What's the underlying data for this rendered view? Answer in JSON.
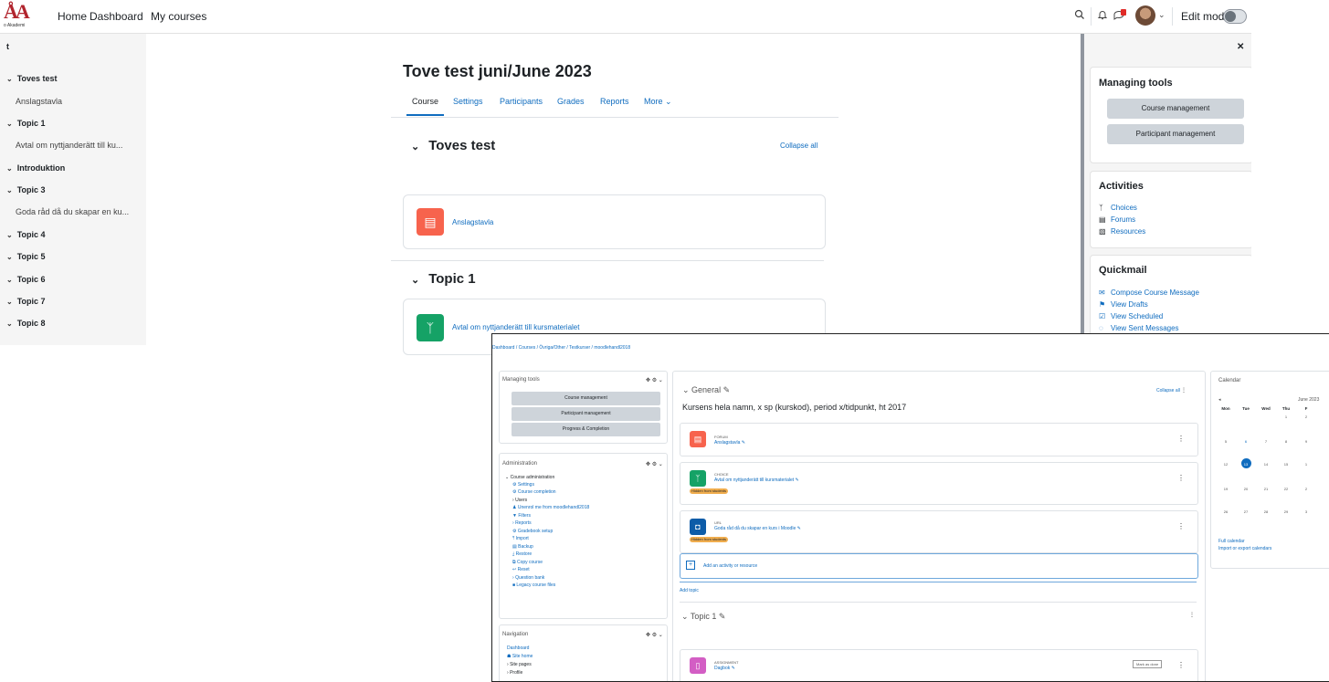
{
  "topbar": {
    "logo_text": "o Akademi",
    "nav": [
      "Home",
      "Dashboard",
      "My courses"
    ],
    "edit_mode_label": "Edit mode",
    "icons": [
      "search-icon",
      "bell-icon",
      "chat-icon",
      "avatar",
      "chevron-down-icon"
    ]
  },
  "left_drawer": {
    "top_label": "t",
    "items": [
      {
        "label": "Toves test",
        "bold": true
      },
      {
        "label": "Anslagstavla",
        "bold": false
      },
      {
        "label": "Topic 1",
        "bold": true
      },
      {
        "label": "Avtal om nyttjanderätt till ku...",
        "bold": false
      },
      {
        "label": "Introduktion",
        "bold": true
      },
      {
        "label": "Topic 3",
        "bold": true
      },
      {
        "label": "Goda råd då du skapar en ku...",
        "bold": false
      },
      {
        "label": "Topic 4",
        "bold": true
      },
      {
        "label": "Topic 5",
        "bold": true
      },
      {
        "label": "Topic 6",
        "bold": true
      },
      {
        "label": "Topic 7",
        "bold": true
      },
      {
        "label": "Topic 8",
        "bold": true
      }
    ]
  },
  "main": {
    "course_title": "Tove test juni/June 2023",
    "tabs": [
      "Course",
      "Settings",
      "Participants",
      "Grades",
      "Reports",
      "More"
    ],
    "collapse_all": "Collapse all",
    "sections": [
      {
        "title": "Toves test",
        "activity": "Anslagstavla",
        "icon": "forum-icon",
        "color": "#f7634d"
      },
      {
        "title": "Topic 1",
        "activity": "Avtal om nyttjanderätt till kursmaterialet",
        "icon": "choice-icon",
        "color": "#15a266"
      }
    ]
  },
  "right_drawer": {
    "managing_tools": {
      "title": "Managing tools",
      "buttons": [
        "Course management",
        "Participant management"
      ]
    },
    "activities": {
      "title": "Activities",
      "links": [
        {
          "label": "Choices",
          "icon": "choice-icon"
        },
        {
          "label": "Forums",
          "icon": "forum-icon"
        },
        {
          "label": "Resources",
          "icon": "file-icon"
        }
      ]
    },
    "quickmail": {
      "title": "Quickmail",
      "links": [
        {
          "label": "Compose Course Message",
          "icon": "envelope-icon"
        },
        {
          "label": "View Drafts",
          "icon": "flag-icon"
        },
        {
          "label": "View Scheduled",
          "icon": "calendar-check-icon"
        },
        {
          "label": "View Sent Messages",
          "icon": "chat-bubble-icon"
        }
      ]
    }
  },
  "overlay": {
    "breadcrumb": "Dashboard / Courses / Övriga/Other / Testkurser / moodlehandl2018",
    "managing_tools": {
      "title": "Managing tools",
      "buttons": [
        "Course management",
        "Participant management",
        "Progress & Completion"
      ]
    },
    "administration": {
      "title": "Administration",
      "heading": "Course administration",
      "items": [
        "Settings",
        "Course completion",
        "Users",
        "Unenrol me from moodlehandl2018",
        "Filters",
        "Reports",
        "Gradebook setup",
        "Import",
        "Backup",
        "Restore",
        "Copy course",
        "Reset",
        "Question bank",
        "Legacy course files"
      ]
    },
    "navigation": {
      "title": "Navigation",
      "items": [
        "Dashboard",
        "Site home",
        "Site pages",
        "Profile"
      ]
    },
    "general": {
      "title": "General",
      "collapse_all": "Collapse all",
      "summary": "Kursens hela namn, x sp (kurskod), period x/tidpunkt, ht 2017",
      "activities": [
        {
          "type": "FORUM",
          "name": "Anslagstavla",
          "badge": "",
          "color": "#f7634d"
        },
        {
          "type": "CHOICE",
          "name": "Avtal om nyttjanderätt till kursmaterialet",
          "badge": "Hidden from students",
          "color": "#15a266"
        },
        {
          "type": "URL",
          "name": "Goda råd då du skapar en kurs i Moodle",
          "badge": "Hidden from students",
          "color": "#0d5ca8"
        }
      ],
      "add_activity": "Add an activity or resource",
      "add_topic": "Add topic"
    },
    "topic1": {
      "title": "Topic 1",
      "activity": {
        "type": "ASSIGNMENT",
        "name": "Dagbok",
        "button": "Mark as done",
        "color": "#d35ec4"
      }
    },
    "calendar": {
      "title": "Calendar",
      "month": "June 2023",
      "prev": "◂",
      "days": [
        "Mon",
        "Tue",
        "Wed",
        "Thu",
        "F"
      ],
      "weeks": [
        [
          "",
          "",
          "",
          "1",
          "2"
        ],
        [
          "5",
          "6",
          "7",
          "8",
          "9"
        ],
        [
          "12",
          "13",
          "14",
          "15",
          "1"
        ],
        [
          "19",
          "20",
          "21",
          "22",
          "2"
        ],
        [
          "26",
          "27",
          "28",
          "29",
          "3"
        ]
      ],
      "today": "13",
      "links": [
        "Full calendar",
        "Import or export calendars"
      ]
    }
  }
}
